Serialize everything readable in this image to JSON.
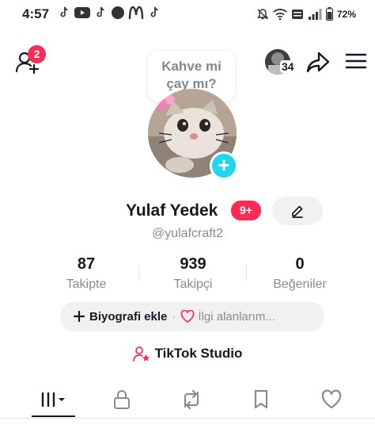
{
  "status_bar": {
    "time": "4:57",
    "battery": "72%",
    "left_icons": [
      "tiktok-icon",
      "youtube-icon",
      "tiktok-icon",
      "record-icon",
      "mcdonalds-icon",
      "tiktok-icon"
    ],
    "right_icons": [
      "mute-icon",
      "wifi-icon",
      "volte-icon",
      "signal-icon",
      "battery-icon"
    ]
  },
  "header": {
    "add_friends_badge": "2",
    "story_count": "34"
  },
  "profile": {
    "note_line1": "Kahve mi",
    "note_line2": "çay mı?",
    "display_name": "Yulaf Yedek",
    "notif_badge": "9+",
    "username": "@yulafcraft2"
  },
  "stats": [
    {
      "value": "87",
      "label": "Takipte"
    },
    {
      "value": "939",
      "label": "Takipçi"
    },
    {
      "value": "0",
      "label": "Beğeniler"
    }
  ],
  "bio": {
    "add_label": "Biyografi ekle",
    "separator": "·",
    "interests_label": "İlgi alanlarım..."
  },
  "studio": {
    "label": "TikTok Studio"
  },
  "tabs": [
    {
      "name": "videos",
      "icon": "grid-icon",
      "active": true
    },
    {
      "name": "private",
      "icon": "lock-icon",
      "active": false
    },
    {
      "name": "reposts",
      "icon": "repost-icon",
      "active": false
    },
    {
      "name": "favorites",
      "icon": "bookmark-icon",
      "active": false
    },
    {
      "name": "liked",
      "icon": "heart-icon",
      "active": false
    }
  ],
  "colors": {
    "accent": "#fe2c55",
    "add_story": "#20d5ec",
    "text": "#161823",
    "muted": "#8a8b91"
  }
}
